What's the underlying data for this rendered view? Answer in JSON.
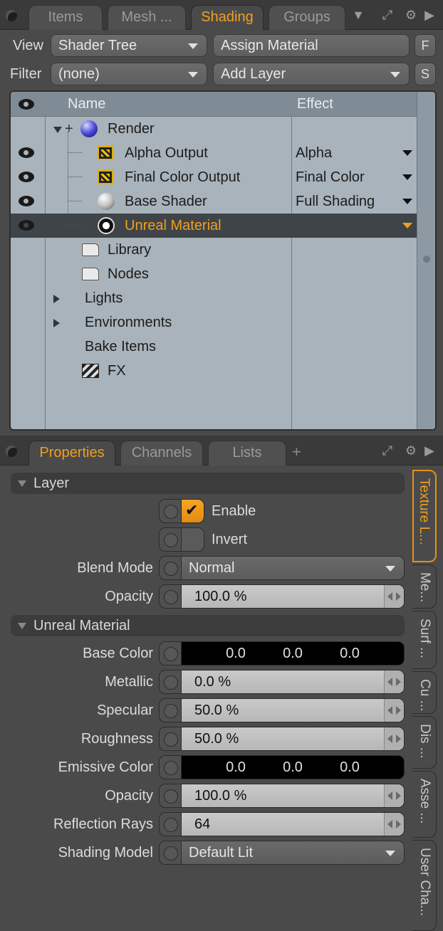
{
  "top_tabs": {
    "items": [
      "Items",
      "Mesh ...",
      "Shading",
      "Groups"
    ],
    "active": "Shading"
  },
  "shader_panel": {
    "view_label": "View",
    "view_value": "Shader Tree",
    "assign_material": "Assign Material",
    "f_button": "F",
    "filter_label": "Filter",
    "filter_value": "(none)",
    "add_layer": "Add Layer",
    "s_button": "S"
  },
  "tree": {
    "columns": {
      "name": "Name",
      "effect": "Effect"
    },
    "rows": [
      {
        "name": "Render",
        "effect": ""
      },
      {
        "name": "Alpha Output",
        "effect": "Alpha"
      },
      {
        "name": "Final Color Output",
        "effect": "Final Color"
      },
      {
        "name": "Base Shader",
        "effect": "Full Shading"
      },
      {
        "name": "Unreal Material",
        "effect": ""
      },
      {
        "name": "Library",
        "effect": ""
      },
      {
        "name": "Nodes",
        "effect": ""
      },
      {
        "name": "Lights",
        "effect": ""
      },
      {
        "name": "Environments",
        "effect": ""
      },
      {
        "name": "Bake Items",
        "effect": ""
      },
      {
        "name": "FX",
        "effect": ""
      }
    ]
  },
  "bottom_tabs": {
    "items": [
      "Properties",
      "Channels",
      "Lists"
    ],
    "active": "Properties",
    "add": "+"
  },
  "properties": {
    "layer_section": "Layer",
    "enable_label": "Enable",
    "enable_checked": true,
    "invert_label": "Invert",
    "invert_checked": false,
    "blend_mode_label": "Blend Mode",
    "blend_mode_value": "Normal",
    "layer_opacity_label": "Opacity",
    "layer_opacity_value": "100.0 %",
    "material_section": "Unreal Material",
    "base_color_label": "Base Color",
    "base_color": [
      "0.0",
      "0.0",
      "0.0"
    ],
    "metallic_label": "Metallic",
    "metallic_value": "0.0 %",
    "specular_label": "Specular",
    "specular_value": "50.0 %",
    "roughness_label": "Roughness",
    "roughness_value": "50.0 %",
    "emissive_label": "Emissive Color",
    "emissive_color": [
      "0.0",
      "0.0",
      "0.0"
    ],
    "mat_opacity_label": "Opacity",
    "mat_opacity_value": "100.0 %",
    "reflection_rays_label": "Reflection Rays",
    "reflection_rays_value": "64",
    "shading_model_label": "Shading Model",
    "shading_model_value": "Default Lit"
  },
  "side_tabs": [
    "Texture L...",
    "Me...",
    "Surf ...",
    "Cu ...",
    "Dis ...",
    "Asse ...",
    "User Cha..."
  ],
  "colors": {
    "accent": "#f0a020",
    "tree_bg": "#a9b3bb",
    "selected_row": "#3f4449"
  }
}
